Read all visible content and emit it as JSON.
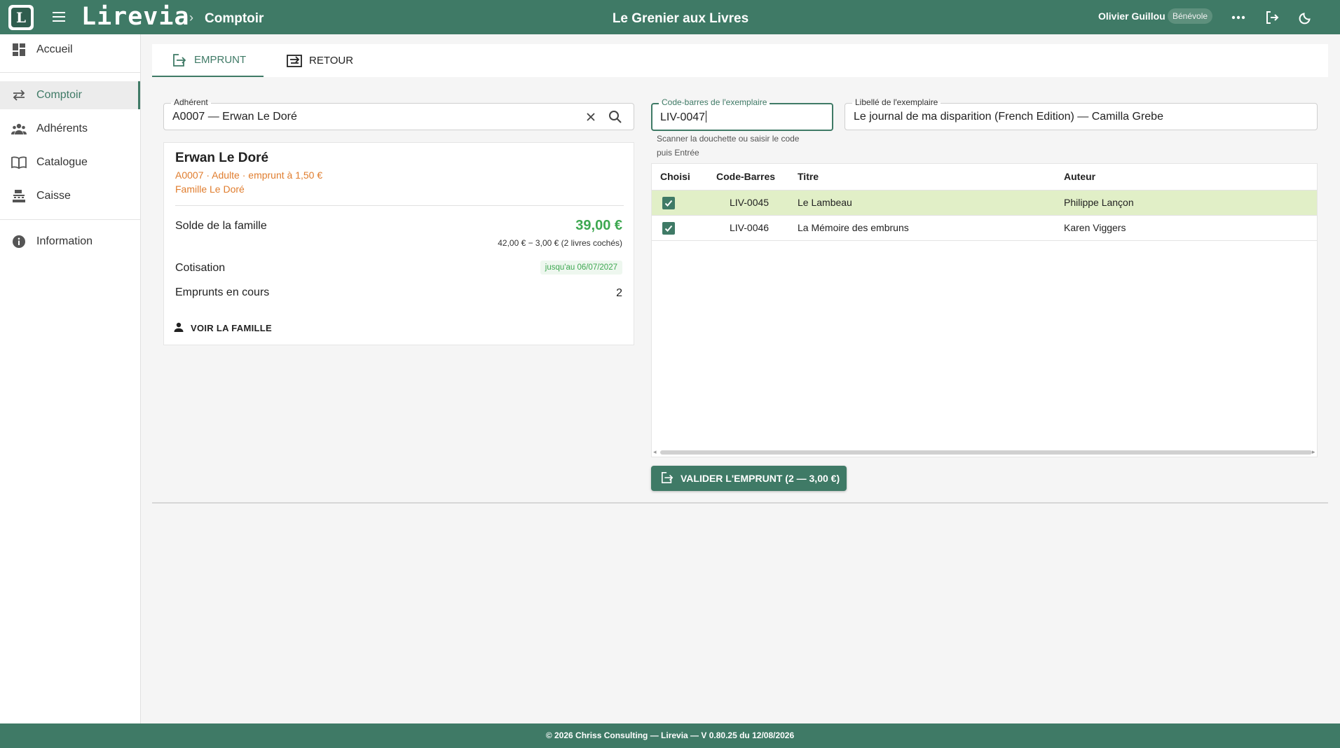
{
  "app": {
    "brand": "Lirevia",
    "breadcrumb_sep": "›",
    "page_title": "Comptoir",
    "library_name": "Le Grenier aux Livres",
    "user_name": "Olivier Guillou",
    "user_role": "Bénévole",
    "accent": "#3f7a66",
    "logo_letter": "L"
  },
  "sidebar": {
    "items": [
      {
        "label": "Accueil",
        "icon": "dashboard-icon"
      },
      {
        "label": "Comptoir",
        "icon": "swap-icon"
      },
      {
        "label": "Adhérents",
        "icon": "people-icon"
      },
      {
        "label": "Catalogue",
        "icon": "book-icon"
      },
      {
        "label": "Caisse",
        "icon": "cash-register-icon"
      },
      {
        "label": "Information",
        "icon": "info-icon"
      }
    ],
    "active": "Comptoir"
  },
  "tabs": [
    {
      "label": "EMPRUNT",
      "icon": "checkout-icon",
      "active": true
    },
    {
      "label": "RETOUR",
      "icon": "return-icon",
      "active": false
    }
  ],
  "member_field": {
    "label": "Adhérent",
    "value": "A0007 — Erwan Le Doré"
  },
  "member": {
    "name": "Erwan Le Doré",
    "info": "A0007 · Adulte · emprunt à 1,50 €",
    "family": "Famille Le Doré",
    "balance_label": "Solde de la famille",
    "balance": "39,00 €",
    "balance_detail": "42,00 € − 3,00 € (2 livres cochés)",
    "subscription_label": "Cotisation",
    "subscription_badge": "jusqu'au 06/07/2027",
    "loans_label": "Emprunts en cours",
    "loans_count": "2",
    "see_family": "VOIR LA FAMILLE"
  },
  "barcode_field": {
    "label": "Code-barres de l'exemplaire",
    "value": "LIV-0047",
    "hint_line1": "Scanner la douchette ou saisir le code",
    "hint_line2": "puis Entrée"
  },
  "title_field": {
    "label": "Libellé de l'exemplaire",
    "value": "Le journal de ma disparition (French Edition) — Camilla Grebe"
  },
  "table": {
    "columns": [
      "Choisi",
      "Code-Barres",
      "Titre",
      "Auteur"
    ],
    "rows": [
      {
        "checked": true,
        "code": "LIV-0045",
        "title": "Le Lambeau",
        "author": "Philippe Lançon",
        "highlight": true
      },
      {
        "checked": true,
        "code": "LIV-0046",
        "title": "La Mémoire des embruns",
        "author": "Karen Viggers",
        "highlight": false
      }
    ]
  },
  "validate_button": "VALIDER L'EMPRUNT (2 — 3,00 €)",
  "footer": "© 2026 Chriss Consulting — Lirevia — V 0.80.25 du 12/08/2026"
}
